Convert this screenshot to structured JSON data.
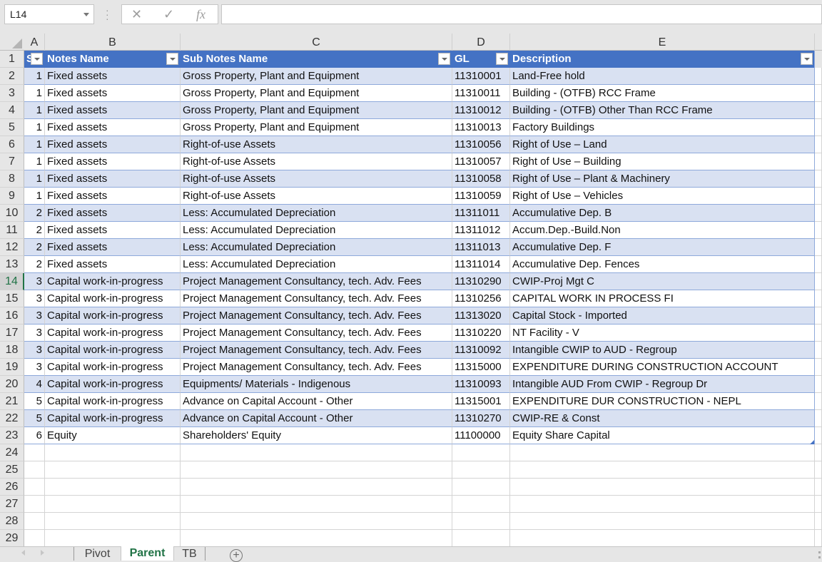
{
  "formula_bar": {
    "name_box": "L14",
    "cancel_icon": "✕",
    "enter_icon": "✓",
    "fx_label": "fx",
    "formula": ""
  },
  "columns": [
    "A",
    "B",
    "C",
    "D",
    "E"
  ],
  "table": {
    "headers": {
      "a": "S",
      "b": "Notes Name",
      "c": "Sub Notes Name",
      "d": "GL",
      "e": "Description"
    },
    "rows": [
      {
        "a": "1",
        "b": "Fixed assets",
        "c": "Gross Property, Plant and Equipment",
        "d": "11310001",
        "e": "Land-Free hold"
      },
      {
        "a": "1",
        "b": "Fixed assets",
        "c": "Gross Property, Plant and Equipment",
        "d": "11310011",
        "e": "Building - (OTFB) RCC Frame"
      },
      {
        "a": "1",
        "b": "Fixed assets",
        "c": "Gross Property, Plant and Equipment",
        "d": "11310012",
        "e": "Building - (OTFB) Other Than RCC Frame"
      },
      {
        "a": "1",
        "b": "Fixed assets",
        "c": "Gross Property, Plant and Equipment",
        "d": "11310013",
        "e": "Factory Buildings"
      },
      {
        "a": "1",
        "b": "Fixed assets",
        "c": "Right-of-use Assets",
        "d": "11310056",
        "e": "Right of Use – Land"
      },
      {
        "a": "1",
        "b": "Fixed assets",
        "c": "Right-of-use Assets",
        "d": "11310057",
        "e": "Right of Use – Building"
      },
      {
        "a": "1",
        "b": "Fixed assets",
        "c": "Right-of-use Assets",
        "d": "11310058",
        "e": "Right of Use – Plant & Machinery"
      },
      {
        "a": "1",
        "b": "Fixed assets",
        "c": "Right-of-use Assets",
        "d": "11310059",
        "e": "Right of Use – Vehicles"
      },
      {
        "a": "2",
        "b": "Fixed assets",
        "c": "Less: Accumulated Depreciation",
        "d": "11311011",
        "e": "Accumulative Dep. B"
      },
      {
        "a": "2",
        "b": "Fixed assets",
        "c": "Less: Accumulated Depreciation",
        "d": "11311012",
        "e": "Accum.Dep.-Build.Non"
      },
      {
        "a": "2",
        "b": "Fixed assets",
        "c": "Less: Accumulated Depreciation",
        "d": "11311013",
        "e": "Accumulative Dep. F"
      },
      {
        "a": "2",
        "b": "Fixed assets",
        "c": "Less: Accumulated Depreciation",
        "d": "11311014",
        "e": "Accumulative Dep. Fences"
      },
      {
        "a": "3",
        "b": "Capital work-in-progress",
        "c": "Project Management Consultancy, tech. Adv. Fees",
        "d": "11310290",
        "e": "CWIP-Proj Mgt C"
      },
      {
        "a": "3",
        "b": "Capital work-in-progress",
        "c": "Project Management Consultancy, tech. Adv. Fees",
        "d": "11310256",
        "e": "CAPITAL WORK IN PROCESS FI"
      },
      {
        "a": "3",
        "b": "Capital work-in-progress",
        "c": "Project Management Consultancy, tech. Adv. Fees",
        "d": "11313020",
        "e": "Capital Stock - Imported"
      },
      {
        "a": "3",
        "b": "Capital work-in-progress",
        "c": "Project Management Consultancy, tech. Adv. Fees",
        "d": "11310220",
        "e": "NT Facility - V"
      },
      {
        "a": "3",
        "b": "Capital work-in-progress",
        "c": "Project Management Consultancy, tech. Adv. Fees",
        "d": "11310092",
        "e": "Intangible CWIP to AUD - Regroup"
      },
      {
        "a": "3",
        "b": "Capital work-in-progress",
        "c": "Project Management Consultancy, tech. Adv. Fees",
        "d": "11315000",
        "e": "EXPENDITURE DURING CONSTRUCTION ACCOUNT"
      },
      {
        "a": "4",
        "b": "Capital work-in-progress",
        "c": "Equipments/ Materials - Indigenous",
        "d": "11310093",
        "e": "Intangible AUD From CWIP - Regroup Dr"
      },
      {
        "a": "5",
        "b": "Capital work-in-progress",
        "c": "Advance on Capital Account - Other",
        "d": "11315001",
        "e": "EXPENDITURE DUR CONSTRUCTION - NEPL"
      },
      {
        "a": "5",
        "b": "Capital work-in-progress",
        "c": "Advance on Capital Account - Other",
        "d": "11310270",
        "e": "CWIP-RE & Const"
      },
      {
        "a": "6",
        "b": "Equity",
        "c": "Shareholders' Equity",
        "d": "11100000",
        "e": "Equity Share Capital"
      }
    ]
  },
  "row_numbers": [
    "1",
    "2",
    "3",
    "4",
    "5",
    "6",
    "7",
    "8",
    "9",
    "10",
    "11",
    "12",
    "13",
    "14",
    "15",
    "16",
    "17",
    "18",
    "19",
    "20",
    "21",
    "22",
    "23",
    "24",
    "25",
    "26",
    "27",
    "28",
    "29"
  ],
  "selected_row": "14",
  "sheet_tabs": [
    {
      "label": "Pivot",
      "active": false
    },
    {
      "label": "Parent",
      "active": true
    },
    {
      "label": "TB",
      "active": false
    }
  ],
  "add_sheet_label": "+",
  "colors": {
    "header_bg": "#4472c4",
    "band_bg": "#d9e1f2",
    "active_tab": "#217346"
  }
}
